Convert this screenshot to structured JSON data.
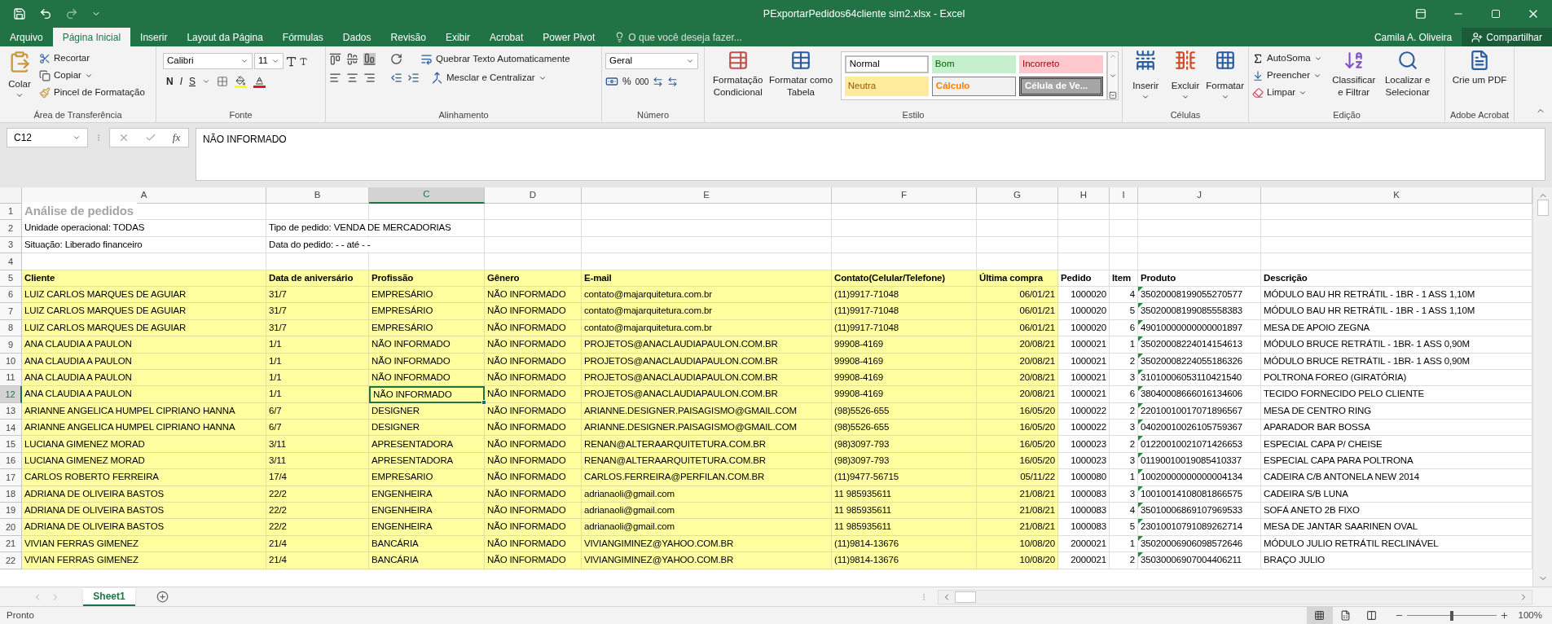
{
  "window": {
    "title": "PExportarPedidos64cliente sim2.xlsx - Excel",
    "user": "Camila A. Oliveira",
    "share": "Compartilhar"
  },
  "tabs": [
    {
      "label": "Arquivo",
      "selected": false
    },
    {
      "label": "Página Inicial",
      "selected": true
    },
    {
      "label": "Inserir",
      "selected": false
    },
    {
      "label": "Layout da Página",
      "selected": false
    },
    {
      "label": "Fórmulas",
      "selected": false
    },
    {
      "label": "Dados",
      "selected": false
    },
    {
      "label": "Revisão",
      "selected": false
    },
    {
      "label": "Exibir",
      "selected": false
    },
    {
      "label": "Acrobat",
      "selected": false
    },
    {
      "label": "Power Pivot",
      "selected": false
    }
  ],
  "tell_me": {
    "placeholder": "O que você deseja fazer..."
  },
  "ribbon": {
    "clipboard": {
      "label": "Área de Transferência",
      "paste": "Colar",
      "cut": "Recortar",
      "copy": "Copiar",
      "painter": "Pincel de Formatação"
    },
    "font": {
      "label": "Fonte",
      "name": "Calibri",
      "size": "11",
      "bold": "N",
      "italic": "I",
      "underline": "S"
    },
    "alignment": {
      "label": "Alinhamento",
      "wrap": "Quebrar Texto Automaticamente",
      "merge": "Mesclar e Centralizar"
    },
    "number": {
      "label": "Número",
      "format": "Geral",
      "percent": "%",
      "thousands": "000"
    },
    "styles": {
      "label": "Estilo",
      "conditional": "Formatação Condicional",
      "table": "Formatar como Tabela",
      "cell_styles": [
        {
          "label": "Normal",
          "kind": "normal"
        },
        {
          "label": "Bom",
          "kind": "good"
        },
        {
          "label": "Incorreto",
          "kind": "bad"
        },
        {
          "label": "Neutra",
          "kind": "neutral"
        },
        {
          "label": "Cálculo",
          "kind": "calc"
        },
        {
          "label": "Célula de Ve...",
          "kind": "check"
        }
      ]
    },
    "cells": {
      "label": "Células",
      "insert": "Inserir",
      "delete": "Excluir",
      "format": "Formatar"
    },
    "editing": {
      "label": "Edição",
      "autosum": "AutoSoma",
      "fill": "Preencher",
      "clear": "Limpar",
      "sort": "Classificar e Filtrar",
      "find": "Localizar e Selecionar"
    },
    "acrobat": {
      "label": "Adobe Acrobat",
      "create": "Crie um PDF"
    }
  },
  "formula_bar": {
    "name_box": "C12",
    "fx": "fx",
    "value": "NÃO INFORMADO"
  },
  "columns": [
    {
      "letter": "A",
      "selected": false,
      "shaded": true
    },
    {
      "letter": "B",
      "selected": false,
      "shaded": true
    },
    {
      "letter": "C",
      "selected": true,
      "shaded": true
    },
    {
      "letter": "D",
      "selected": false,
      "shaded": true
    },
    {
      "letter": "E",
      "selected": false,
      "shaded": true
    },
    {
      "letter": "F",
      "selected": false,
      "shaded": true
    },
    {
      "letter": "G",
      "selected": false,
      "shaded": true,
      "numeric": true
    },
    {
      "letter": "H",
      "selected": false,
      "shaded": false,
      "numeric": true
    },
    {
      "letter": "I",
      "selected": false,
      "shaded": false,
      "numeric": true
    },
    {
      "letter": "J",
      "selected": false,
      "shaded": false,
      "flagged": true
    },
    {
      "letter": "K",
      "selected": false,
      "shaded": false
    }
  ],
  "rows": [
    {
      "number": "1",
      "kind": "title",
      "selected": false,
      "shaded": false,
      "cells": [
        "Análise de pedidos"
      ]
    },
    {
      "number": "2",
      "kind": "info",
      "selected": false,
      "shaded": false,
      "cells": [
        "Unidade operacional: TODAS",
        "Tipo de pedido: VENDA DE MERCADORIAS"
      ]
    },
    {
      "number": "3",
      "kind": "info",
      "selected": false,
      "shaded": false,
      "cells": [
        "Situação: Liberado financeiro",
        "Data do pedido:    - -   até    - -"
      ]
    },
    {
      "number": "4",
      "kind": "info",
      "selected": false,
      "shaded": false
    },
    {
      "number": "5",
      "kind": "header",
      "selected": false,
      "shaded": true,
      "cells": [
        "Cliente",
        "Data de aniversário",
        "Profissão",
        "Gênero",
        "E-mail",
        "Contato(Celular/Telefone)",
        "Última compra",
        "Pedido",
        "Item",
        "Produto",
        "Descrição"
      ]
    },
    {
      "number": "6",
      "kind": "data",
      "selected": false,
      "shaded": true,
      "cells": [
        "LUIZ CARLOS MARQUES DE AGUIAR",
        "31/7",
        "EMPRESÁRIO",
        "NÃO INFORMADO",
        "contato@majarquitetura.com.br",
        "(11)9917-71048",
        "06/01/21",
        "1000020",
        "4",
        "35020008199055270577",
        "MÓDULO BAU HR RETRÁTIL - 1BR - 1 ASS 1,10M"
      ]
    },
    {
      "number": "7",
      "kind": "data",
      "selected": false,
      "shaded": true,
      "cells": [
        "LUIZ CARLOS MARQUES DE AGUIAR",
        "31/7",
        "EMPRESÁRIO",
        "NÃO INFORMADO",
        "contato@majarquitetura.com.br",
        "(11)9917-71048",
        "06/01/21",
        "1000020",
        "5",
        "35020008199085558383",
        "MÓDULO BAU HR RETRÁTIL - 1BR - 1 ASS 1,10M"
      ]
    },
    {
      "number": "8",
      "kind": "data",
      "selected": false,
      "shaded": true,
      "cells": [
        "LUIZ CARLOS MARQUES DE AGUIAR",
        "31/7",
        "EMPRESÁRIO",
        "NÃO INFORMADO",
        "contato@majarquitetura.com.br",
        "(11)9917-71048",
        "06/01/21",
        "1000020",
        "6",
        "49010000000000001897",
        "MESA DE APOIO ZEGNA"
      ]
    },
    {
      "number": "9",
      "kind": "data",
      "selected": false,
      "shaded": true,
      "cells": [
        "ANA CLAUDIA A PAULON",
        "1/1",
        "NÃO INFORMADO",
        "NÃO INFORMADO",
        "PROJETOS@ANACLAUDIAPAULON.COM.BR",
        "99908-4169",
        "20/08/21",
        "1000021",
        "1",
        "35020008224014154613",
        "MÓDULO BRUCE RETRÁTIL - 1BR- 1 ASS 0,90M"
      ]
    },
    {
      "number": "10",
      "kind": "data",
      "selected": false,
      "shaded": true,
      "cells": [
        "ANA CLAUDIA A PAULON",
        "1/1",
        "NÃO INFORMADO",
        "NÃO INFORMADO",
        "PROJETOS@ANACLAUDIAPAULON.COM.BR",
        "99908-4169",
        "20/08/21",
        "1000021",
        "2",
        "35020008224055186326",
        "MÓDULO BRUCE RETRÁTIL - 1BR- 1 ASS 0,90M"
      ]
    },
    {
      "number": "11",
      "kind": "data",
      "selected": false,
      "shaded": true,
      "cells": [
        "ANA CLAUDIA A PAULON",
        "1/1",
        "NÃO INFORMADO",
        "NÃO INFORMADO",
        "PROJETOS@ANACLAUDIAPAULON.COM.BR",
        "99908-4169",
        "20/08/21",
        "1000021",
        "3",
        "31010006053110421540",
        "POLTRONA FOREO (GIRATÓRIA)"
      ]
    },
    {
      "number": "12",
      "kind": "data",
      "selected": true,
      "shaded": true,
      "cells": [
        "ANA CLAUDIA A PAULON",
        "1/1",
        "NÃO INFORMADO",
        "NÃO INFORMADO",
        "PROJETOS@ANACLAUDIAPAULON.COM.BR",
        "99908-4169",
        "20/08/21",
        "1000021",
        "6",
        "38040008666016134606",
        "TECIDO FORNECIDO PELO CLIENTE"
      ]
    },
    {
      "number": "13",
      "kind": "data",
      "selected": false,
      "shaded": true,
      "cells": [
        "ARIANNE ANGELICA HUMPEL CIPRIANO HANNA",
        "6/7",
        "DESIGNER",
        "NÃO INFORMADO",
        "ARIANNE.DESIGNER.PAISAGISMO@GMAIL.COM",
        "(98)5526-655",
        "16/05/20",
        "1000022",
        "2",
        "22010010017071896567",
        "MESA DE CENTRO RING"
      ]
    },
    {
      "number": "14",
      "kind": "data",
      "selected": false,
      "shaded": true,
      "cells": [
        "ARIANNE ANGELICA HUMPEL CIPRIANO HANNA",
        "6/7",
        "DESIGNER",
        "NÃO INFORMADO",
        "ARIANNE.DESIGNER.PAISAGISMO@GMAIL.COM",
        "(98)5526-655",
        "16/05/20",
        "1000022",
        "3",
        "04020010026105759367",
        "APARADOR BAR BOSSA"
      ]
    },
    {
      "number": "15",
      "kind": "data",
      "selected": false,
      "shaded": true,
      "cells": [
        "LUCIANA GIMENEZ MORAD",
        "3/11",
        "APRESENTADORA",
        "NÃO INFORMADO",
        "RENAN@ALTERAARQUITETURA.COM.BR",
        "(98)3097-793",
        "16/05/20",
        "1000023",
        "2",
        "01220010021071426653",
        "ESPECIAL CAPA P/ CHEISE"
      ]
    },
    {
      "number": "16",
      "kind": "data",
      "selected": false,
      "shaded": true,
      "cells": [
        "LUCIANA GIMENEZ MORAD",
        "3/11",
        "APRESENTADORA",
        "NÃO INFORMADO",
        "RENAN@ALTERAARQUITETURA.COM.BR",
        "(98)3097-793",
        "16/05/20",
        "1000023",
        "3",
        "01190010019085410337",
        "ESPECIAL CAPA PARA POLTRONA"
      ]
    },
    {
      "number": "17",
      "kind": "data",
      "selected": false,
      "shaded": true,
      "cells": [
        "CARLOS ROBERTO FERREIRA",
        "17/4",
        "EMPRESARIO",
        "NÃO INFORMADO",
        "CARLOS.FERREIRA@PERFILAN.COM.BR",
        "(11)9477-56715",
        "05/11/22",
        "1000080",
        "1",
        "10020000000000004134",
        "CADEIRA C/B ANTONELA NEW 2014"
      ]
    },
    {
      "number": "18",
      "kind": "data",
      "selected": false,
      "shaded": true,
      "cells": [
        "ADRIANA DE OLIVEIRA BASTOS",
        "22/2",
        "ENGENHEIRA",
        "NÃO INFORMADO",
        "adrianaoli@gmail.com",
        "11 985935611",
        "21/08/21",
        "1000083",
        "3",
        "10010014108081866575",
        "CADEIRA S/B LUNA"
      ]
    },
    {
      "number": "19",
      "kind": "data",
      "selected": false,
      "shaded": true,
      "cells": [
        "ADRIANA DE OLIVEIRA BASTOS",
        "22/2",
        "ENGENHEIRA",
        "NÃO INFORMADO",
        "adrianaoli@gmail.com",
        "11 985935611",
        "21/08/21",
        "1000083",
        "4",
        "35010006869107969533",
        "SOFÁ ANETO 2B FIXO"
      ]
    },
    {
      "number": "20",
      "kind": "data",
      "selected": false,
      "shaded": true,
      "cells": [
        "ADRIANA DE OLIVEIRA BASTOS",
        "22/2",
        "ENGENHEIRA",
        "NÃO INFORMADO",
        "adrianaoli@gmail.com",
        "11 985935611",
        "21/08/21",
        "1000083",
        "5",
        "23010010791089262714",
        "MESA DE JANTAR SAARINEN OVAL"
      ]
    },
    {
      "number": "21",
      "kind": "data",
      "selected": false,
      "shaded": true,
      "cells": [
        "VIVIAN FERRAS GIMENEZ",
        "21/4",
        "BANCÁRIA",
        "NÃO INFORMADO",
        "VIVIANGIMINEZ@YAHOO.COM.BR",
        "(11)9814-13676",
        "10/08/20",
        "2000021",
        "1",
        "35020006906098572646",
        "MÓDULO JULIO RETRÁTIL RECLINÁVEL"
      ]
    },
    {
      "number": "22",
      "kind": "data",
      "selected": false,
      "shaded": true,
      "cells": [
        "VIVIAN FERRAS GIMENEZ",
        "21/4",
        "BANCÁRIA",
        "NÃO INFORMADO",
        "VIVIANGIMINEZ@YAHOO.COM.BR",
        "(11)9814-13676",
        "10/08/20",
        "2000021",
        "2",
        "35030006907004406211",
        "BRAÇO JULIO"
      ]
    }
  ],
  "sheets": [
    {
      "label": "Sheet1",
      "selected": true
    }
  ],
  "status_bar": {
    "text": "Pronto",
    "zoom": "100%",
    "level": 0.5
  }
}
